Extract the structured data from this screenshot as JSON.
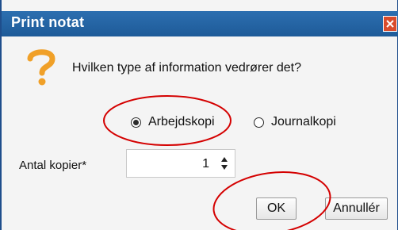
{
  "dialog": {
    "title": "Print notat",
    "question": "Hvilken type af information vedrører det?",
    "options": [
      {
        "label": "Arbejdskopi",
        "selected": true
      },
      {
        "label": "Journalkopi",
        "selected": false
      }
    ],
    "copies_label": "Antal kopier*",
    "copies_value": "1",
    "ok_label": "OK",
    "cancel_label": "Annullér"
  },
  "colors": {
    "titlebar": "#1e5a98",
    "question_icon": "#f0a028",
    "close_button": "#d94b2b",
    "annotation_circle": "#d40000"
  },
  "icons": [
    "question-icon",
    "close-icon",
    "spinner-icon"
  ]
}
